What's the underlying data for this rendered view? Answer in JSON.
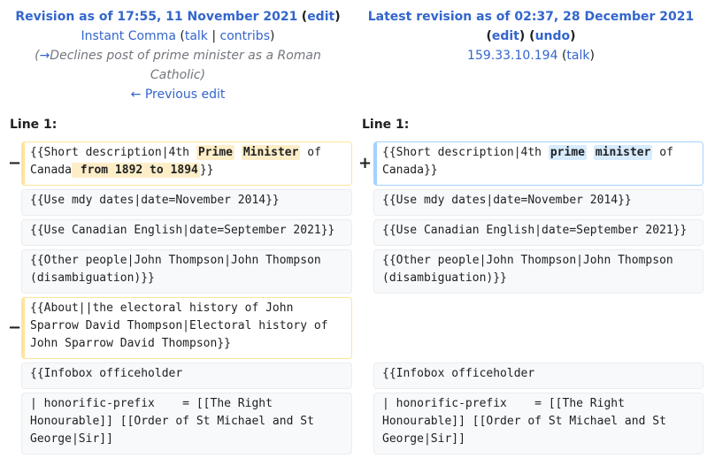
{
  "left_header": {
    "revision_label": "Revision as of 17:55, 11 November 2021",
    "edit_label": "edit",
    "user": "Instant Comma",
    "talk": "talk",
    "contribs": "contribs",
    "summary_arrow": "→",
    "summary": "Declines post of prime minister as a Roman Catholic",
    "prev_edit": "← Previous edit"
  },
  "right_header": {
    "revision_label": "Latest revision as of 02:37, 28 December 2021",
    "edit_label": "edit",
    "undo_label": "undo",
    "user": "159.33.10.194",
    "talk": "talk"
  },
  "line_labels": {
    "left": "Line 1:",
    "right": "Line 1:"
  },
  "markers": {
    "minus": "−",
    "plus": "+"
  },
  "diff": {
    "row1": {
      "left": {
        "pre": "{{Short description|4th ",
        "hl1": "Prime",
        "sp": " ",
        "hl2": "Minister",
        "mid": " of Canada",
        "hl3": " from 1892 to 1894",
        "post": "}}"
      },
      "right": {
        "pre": "{{Short description|4th ",
        "hl1": "prime",
        "sp": " ",
        "hl2": "minister",
        "post": " of Canada}}"
      }
    },
    "row2": "{{Use mdy dates|date=November 2014}}",
    "row3": "{{Use Canadian English|date=September 2021}}",
    "row4": "{{Other people|John Thompson|John Thompson (disambiguation)}}",
    "row5_left": "{{About||the electoral history of John Sparrow David Thompson|Electoral history of John Sparrow David Thompson}}",
    "row6": "{{Infobox officeholder",
    "row7": "| honorific-prefix    = [[The Right Honourable]] [[Order of St Michael and St George|Sir]]"
  }
}
